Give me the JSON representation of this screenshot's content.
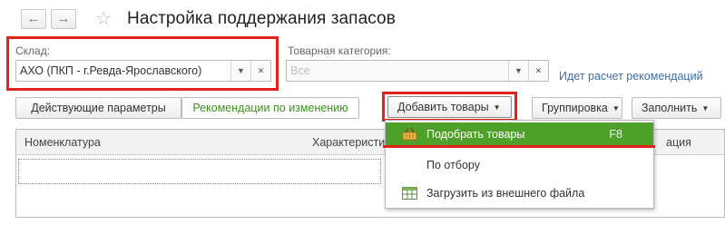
{
  "header": {
    "title": "Настройка поддержания запасов",
    "back_glyph": "←",
    "forward_glyph": "→",
    "star_glyph": "☆"
  },
  "filters": {
    "warehouse": {
      "label": "Склад:",
      "value": "АХО (ПКП - г.Ревда-Ярославского)"
    },
    "category": {
      "label": "Товарная категория:",
      "placeholder": "Все"
    },
    "status_link": "Идет расчет рекомендаций"
  },
  "toolbar": {
    "tab_current_params": "Действующие параметры",
    "tab_change_recs": "Рекомендации по изменению",
    "add_goods": "Добавить товары",
    "grouping": "Группировка",
    "fill": "Заполнить"
  },
  "table": {
    "columns": [
      "Номенклатура",
      "Характеристи",
      "ация"
    ]
  },
  "dropdown": {
    "items": [
      {
        "label": "Подобрать товары",
        "shortcut": "F8",
        "icon": "basket-icon",
        "selected": true
      },
      {
        "label": "По отбору",
        "shortcut": "",
        "icon": "",
        "selected": false
      },
      {
        "label": "Загрузить из внешнего файла",
        "shortcut": "",
        "icon": "table-import-icon",
        "selected": false
      }
    ]
  },
  "colors": {
    "highlight_frame": "#e3221b",
    "selected_item": "#4fa02a",
    "recommend_tab_text": "#3d8f1c",
    "link": "#3c6ea8"
  }
}
